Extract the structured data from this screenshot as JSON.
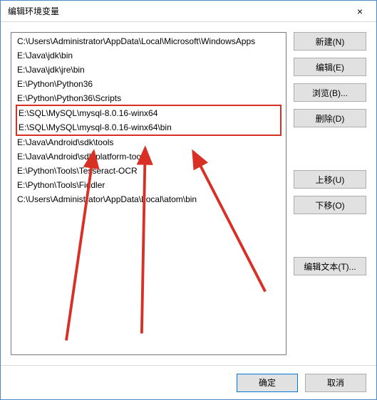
{
  "window": {
    "title": "编辑环境变量",
    "close_label": "×"
  },
  "list": {
    "items": [
      "C:\\Users\\Administrator\\AppData\\Local\\Microsoft\\WindowsApps",
      "E:\\Java\\jdk\\bin",
      "E:\\Java\\jdk\\jre\\bin",
      "E:\\Python\\Python36",
      "E:\\Python\\Python36\\Scripts",
      "E:\\SQL\\MySQL\\mysql-8.0.16-winx64",
      "E:\\SQL\\MySQL\\mysql-8.0.16-winx64\\bin",
      "E:\\Java\\Android\\sdk\\tools",
      "E:\\Java\\Android\\sdk\\platform-tools",
      "E:\\Python\\Tools\\Tesseract-OCR",
      "E:\\Python\\Tools\\Fiddler",
      "C:\\Users\\Administrator\\AppData\\Local\\atom\\bin"
    ],
    "highlight_start": 5,
    "highlight_end": 6
  },
  "side_buttons": {
    "new": "新建(N)",
    "edit": "编辑(E)",
    "browse": "浏览(B)...",
    "delete": "删除(D)",
    "move_up": "上移(U)",
    "move_down": "下移(O)",
    "edit_text": "编辑文本(T)..."
  },
  "footer": {
    "ok": "确定",
    "cancel": "取消"
  },
  "annotation": {
    "color": "#d93025"
  }
}
